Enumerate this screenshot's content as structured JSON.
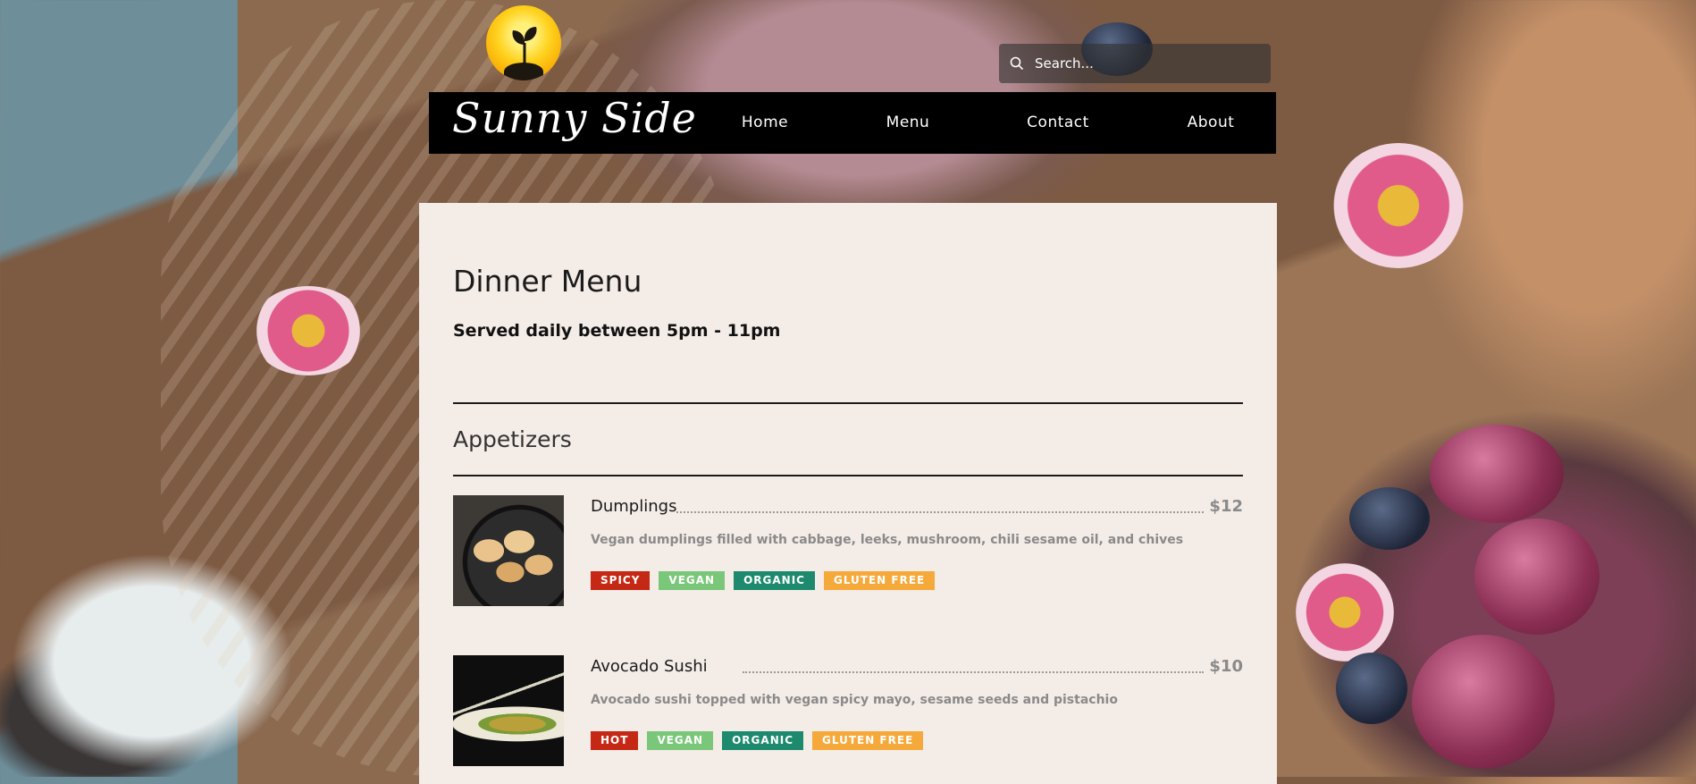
{
  "header": {
    "brand": "Sunny Side",
    "search_placeholder": "Search...",
    "nav": [
      {
        "label": "Home"
      },
      {
        "label": "Menu"
      },
      {
        "label": "Contact"
      },
      {
        "label": "About"
      }
    ]
  },
  "menu": {
    "title": "Dinner Menu",
    "subtitle": "Served daily between 5pm - 11pm",
    "section": "Appetizers",
    "items": [
      {
        "name": "Dumplings",
        "price": "$12",
        "description": "Vegan dumplings filled with cabbage, leeks, mushroom, chili sesame oil, and chives",
        "tags": [
          "SPICY",
          "VEGAN",
          "ORGANIC",
          "GLUTEN FREE"
        ]
      },
      {
        "name": "Avocado Sushi",
        "price": "$10",
        "description": "Avocado sushi topped with vegan spicy mayo, sesame seeds and pistachio",
        "tags": [
          "HOT",
          "VEGAN",
          "ORGANIC",
          "GLUTEN FREE"
        ]
      }
    ]
  },
  "colors": {
    "tag_red": "#c52814",
    "tag_green": "#7ac77a",
    "tag_teal": "#1d8a6e",
    "tag_orange": "#f5a93b",
    "panel": "#f4ece7",
    "navbar": "#000000"
  }
}
